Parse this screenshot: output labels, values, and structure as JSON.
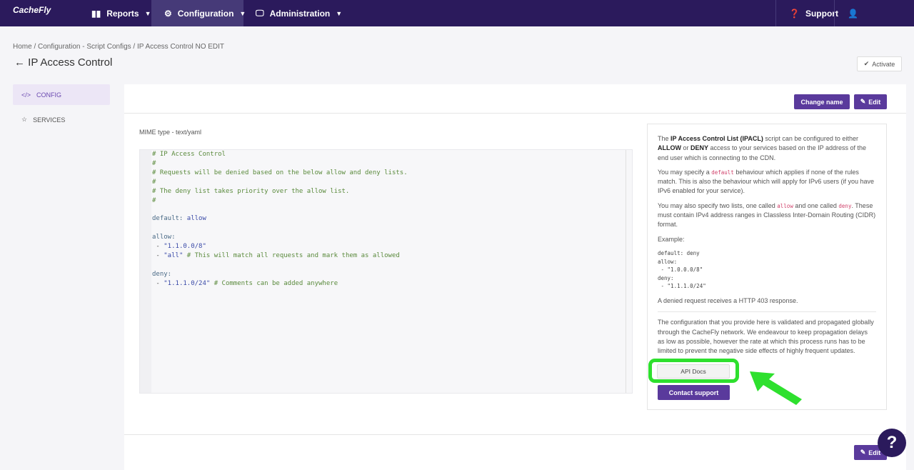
{
  "nav": {
    "brand": "CacheFly",
    "items": [
      {
        "label": "Reports"
      },
      {
        "label": "Configuration"
      },
      {
        "label": "Administration"
      }
    ],
    "support": "Support"
  },
  "breadcrumb": "Home / Configuration - Script Configs / IP Access Control NO EDIT",
  "title": "IP Access Control",
  "activate": "Activate",
  "sidebar": [
    {
      "label": "CONFIG"
    },
    {
      "label": "SERVICES"
    }
  ],
  "buttons": {
    "change_name": "Change name",
    "edit": "Edit",
    "api_docs": "API Docs",
    "contact": "Contact support"
  },
  "mime": "MIME type - text/yaml",
  "code": {
    "l1": "# IP Access Control",
    "l2": "#",
    "l3": "# Requests will be denied based on the below allow and deny lists.",
    "l4": "#",
    "l5": "# The deny list takes priority over the allow list.",
    "l6": "#",
    "default_key": "default:",
    "default_val": "allow",
    "allow_key": "allow:",
    "allow1": "\"1.1.0.0/8\"",
    "allow2": "\"all\"",
    "allow2_comment": "# This will match all requests and mark them as allowed",
    "deny_key": "deny:",
    "deny1": "\"1.1.1.0/24\"",
    "deny1_comment": "# Comments can be added anywhere",
    "dash": " - "
  },
  "help": {
    "p1a": "The ",
    "p1b": "IP Access Control List (IPACL)",
    "p1c": " script can be configured to either ",
    "p1d": "ALLOW",
    "p1e": " or ",
    "p1f": "DENY",
    "p1g": " access to your services based on the IP address of the end user which is connecting to the CDN.",
    "p2a": "You may specify a ",
    "p2b": "default",
    "p2c": " behaviour which applies if none of the rules match. This is also the behaviour which will apply for IPv6 users (if you have IPv6 enabled for your service).",
    "p3a": "You may also specify two lists, one called ",
    "p3b": "allow",
    "p3c": " and one called ",
    "p3d": "deny",
    "p3e": ". These must contain IPv4 address ranges in Classless Inter-Domain Routing (CIDR) format.",
    "example_label": "Example:",
    "example": "default: deny\nallow:\n - \"1.0.0.0/8\"\ndeny:\n - \"1.1.1.0/24\"",
    "p4": "A denied request receives a HTTP 403 response.",
    "p5": "The configuration that you provide here is validated and propagated globally through the CacheFly network. We endeavour to keep propagation delays as low as possible, however the rate at which this process runs has to be limited to prevent the negative side effects of highly frequent updates."
  },
  "help_fab": "?"
}
